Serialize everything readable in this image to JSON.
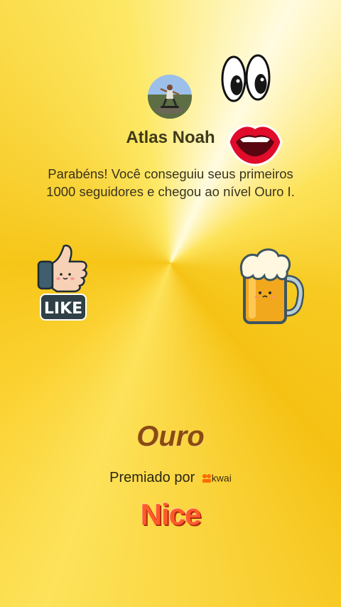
{
  "profile": {
    "name": "Atlas Noah",
    "message": "Parabéns! Você conseguiu seus primeiros 1000 seguidores e chegou ao nível Ouro I."
  },
  "stickers": {
    "eyes": "eyes-icon",
    "mouth": "lips-icon",
    "like": {
      "icon": "thumbs-up-icon",
      "label": "LIKE"
    },
    "beer": "beer-mug-icon"
  },
  "award": {
    "level": "Ouro",
    "awarded_by": "Premiado por",
    "brand": "kwai"
  },
  "badge": "Nice",
  "colors": {
    "background": "#f9d12f",
    "level_text": "#8a4b12",
    "nice": "#ff5a2a"
  }
}
